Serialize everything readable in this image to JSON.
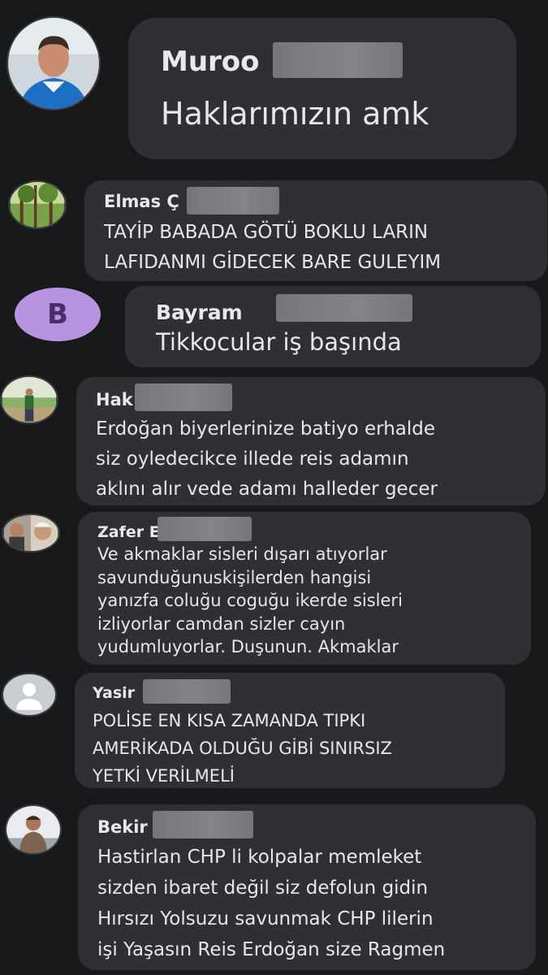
{
  "colors": {
    "background": "#18191b",
    "bubble": "#2f3033",
    "text": "#e4e6eb",
    "redaction": "#828388"
  },
  "comments": [
    {
      "name": "Muroo",
      "text": "Haklarımızın amk",
      "avatar": "man-in-blue-jacket-photo"
    },
    {
      "name": "Elmas Ç",
      "text": "TAYİP BABADA GÖTÜ BOKLU LARIN\nLAFIDANMI GİDECEK BARE GULEYIM",
      "avatar": "forest-photo"
    },
    {
      "name": "Bayram",
      "text": "Tikkocular iş başında",
      "avatar": "B",
      "avatar_color": "#b794e0"
    },
    {
      "name": "Hak",
      "text": "Erdoğan biyerlerinize batiyo erhalde\nsiz oyledecikce illede reis adamın\naklını alır vede adamı halleder gecer",
      "avatar": "man-in-park-photo"
    },
    {
      "name": "Zafer E",
      "text": "Ve akmaklar sisleri dışarı atıyorlar\nsavunduğunuskişilerden hangisi\nyanızfa coluğu coguğu ikerde sisleri\nizliyorlar camdan sizler cayın\nyudumluyorlar. Duşunun. Akmaklar",
      "avatar": "two-men-photo"
    },
    {
      "name": "Yasir",
      "text": "POLİSE EN KISA ZAMANDA TIPKI\nAMERİKADA OLDUĞU GİBİ SINIRSIZ\nYETKİ VERİLMELİ",
      "avatar": "default-user-icon"
    },
    {
      "name": "Bekir",
      "text": "Hastirlan CHP li kolpalar  memleket\nsizden ibaret değil siz defolun gidin\nHırsızı Yolsuzu savunmak CHP lilerin\nişi Yaşasın Reis Erdoğan size Ragmen",
      "avatar": "man-sitting-photo"
    }
  ]
}
